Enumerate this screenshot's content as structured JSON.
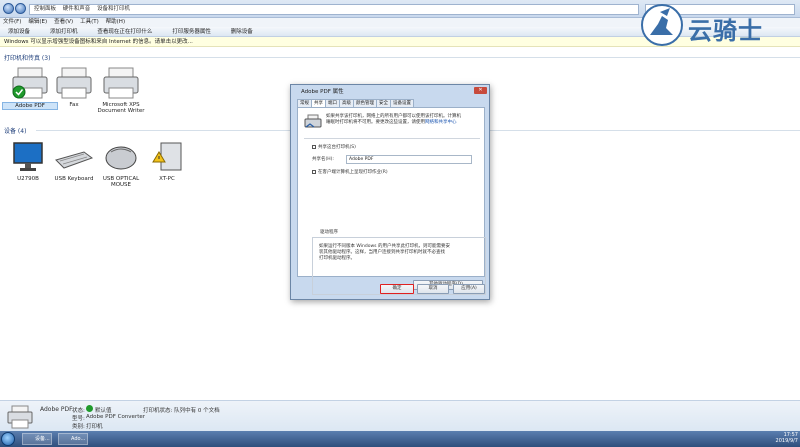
{
  "addressbar": {
    "path": [
      "控制面板",
      "硬件和声音",
      "设备和打印机"
    ],
    "search_placeholder": "搜索 设备和打印机"
  },
  "menubar": [
    "文件(F)",
    "编辑(E)",
    "查看(V)",
    "工具(T)",
    "帮助(H)"
  ],
  "commandbar": [
    "添加设备",
    "添加打印机",
    "查看现在正在打印什么",
    "打印服务器属性",
    "删除设备"
  ],
  "infobar": "Windows 可以显示增强型设备图标和来自 Internet 的信息。请单击以更改...",
  "logo_text": "云骑士",
  "sections": {
    "printers_title": "打印机和传真 (3)",
    "devices_title": "设备 (4)"
  },
  "printers": [
    {
      "label": "Adobe PDF",
      "default": true
    },
    {
      "label": "Fax"
    },
    {
      "label": "Microsoft XPS Document Writer"
    }
  ],
  "devices": [
    {
      "label": "U2790B"
    },
    {
      "label": "USB Keyboard"
    },
    {
      "label": "USB OPTICAL MOUSE"
    },
    {
      "label": "XT-PC"
    }
  ],
  "dialog": {
    "title": "Adobe PDF 属性",
    "tabs": [
      "常规",
      "共享",
      "端口",
      "高级",
      "颜色管理",
      "安全",
      "设备设置"
    ],
    "active_tab": 1,
    "info_line1": "如果共享该打印机，网络上的所有用户都可以使用该打印机。计算机",
    "info_line2": "睡眠时打印机将不可用。要更改这些设置，请使用",
    "info_link": "网络和共享中心",
    "share_checkbox": "共享这台打印机(S)",
    "share_name_label": "共享名(H):",
    "share_name_value": "Adobe PDF",
    "render_checkbox": "在客户端计算机上呈现打印作业(R)",
    "drivers_title": "驱动程序",
    "drivers_text1": "如果运行不同版本 Windows 的用户共享此打印机，则可能需要安",
    "drivers_text2": "装其他驱动程序。这样，当用户连接到共享打印机时就不必查找",
    "drivers_text3": "打印机驱动程序。",
    "other_drivers_button": "其他驱动程序(D)...",
    "ok_button": "确定",
    "cancel_button": "取消",
    "apply_button": "应用(A)"
  },
  "details": {
    "name": "Adobe PDF",
    "status_label": "状态:",
    "status_value": "默认值",
    "printer_status": "打印机状态: 队列中有 0 个文档",
    "model_label": "型号:",
    "model_value": "Adobe PDF Converter",
    "category_label": "类别:",
    "category_value": "打印机"
  },
  "taskbar": {
    "tasks": [
      "设备...",
      "Ado..."
    ],
    "time": "17:57",
    "date": "2019/9/7"
  },
  "colors": {
    "accent": "#1e3e7a",
    "highlight": "#e02020",
    "default_check": "#1f9a2c"
  }
}
